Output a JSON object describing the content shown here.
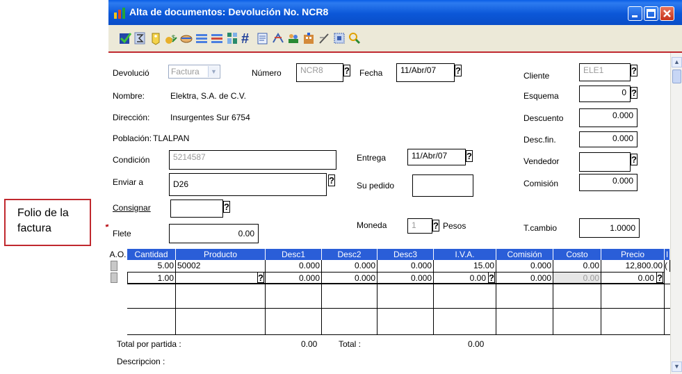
{
  "callout": {
    "line1": "Folio de la",
    "line2": "factura"
  },
  "window": {
    "title": "Alta de documentos: Devolución No. NCR8",
    "buttons": [
      "minimize",
      "maximize",
      "close"
    ]
  },
  "toolbar": {
    "icons": [
      "accept-icon",
      "sum-icon",
      "tag-icon",
      "money-icon",
      "handshake-icon",
      "list-icon",
      "list-alt-icon",
      "grid-icon",
      "hash-icon",
      "notes-icon",
      "calculator-icon",
      "users-icon",
      "building-icon",
      "pen-icon",
      "frame-icon",
      "search-icon"
    ]
  },
  "form": {
    "devolucion_label": "Devolució",
    "devolucion_value": "Factura",
    "numero_label": "Número",
    "numero_value": "NCR8",
    "fecha_label": "Fecha",
    "fecha_value": "11/Abr/07",
    "cliente_label": "Cliente",
    "cliente_value": "ELE1",
    "nombre_label": "Nombre:",
    "nombre_value": "Elektra, S.A. de C.V.",
    "esquema_label": "Esquema",
    "esquema_value": "0",
    "direccion_label": "Dirección:",
    "direccion_value": "Insurgentes Sur 6754",
    "descuento_label": "Descuento",
    "descuento_value": "0.000",
    "poblacion_label": "Población:",
    "poblacion_value": "TLALPAN",
    "descfin_label": "Desc.fin.",
    "descfin_value": "0.000",
    "condicion_label": "Condición",
    "condicion_value": "5214587",
    "entrega_label": "Entrega",
    "entrega_value": "11/Abr/07",
    "vendedor_label": "Vendedor",
    "vendedor_value": "",
    "enviar_label": "Enviar a",
    "enviar_value": "D26",
    "supedido_label": "Su pedido",
    "supedido_value": "",
    "comision_label": "Comisión",
    "comision_value": "0.000",
    "consignar_label": "Consignar",
    "consignar_value": "",
    "moneda_label": "Moneda",
    "moneda_value": "1",
    "moneda_name": "Pesos",
    "flete_label": "Flete",
    "flete_value": "0.00",
    "tcambio_label": "T.cambio",
    "tcambio_value": "1.0000"
  },
  "grid": {
    "headers": [
      "A.O.",
      "Cantidad",
      "Producto",
      "Desc1",
      "Desc2",
      "Desc3",
      "I.V.A.",
      "Comisión",
      "Costo",
      "Precio",
      "I"
    ],
    "rows": [
      [
        "",
        "5.00",
        "50002",
        "0.000",
        "0.000",
        "0.000",
        "15.00",
        "0.000",
        "0.00",
        "12,800.00",
        "("
      ],
      [
        "",
        "1.00",
        "",
        "0.000",
        "0.000",
        "0.000",
        "0.00",
        "0.000",
        "0.00",
        "0.00",
        ""
      ]
    ]
  },
  "footer": {
    "total_partida_label": "Total por partida :",
    "total_partida_value": "0.00",
    "total_label": "Total :",
    "total_value": "0.00",
    "descripcion_label": "Descripcion :"
  }
}
